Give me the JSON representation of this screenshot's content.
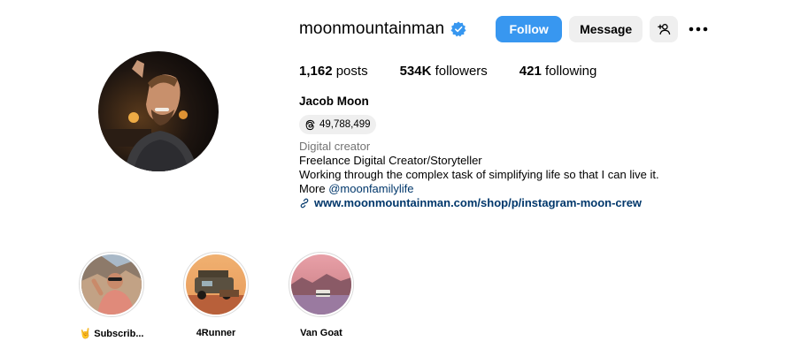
{
  "profile": {
    "username": "moonmountainman",
    "verified_icon": "verified-badge-icon",
    "follow_label": "Follow",
    "message_label": "Message",
    "more_icon": "more-options-icon",
    "add_user_icon": "suggest-user-icon",
    "full_name": "Jacob Moon",
    "threads_count": "49,788,499",
    "threads_icon": "threads-icon",
    "category": "Digital creator",
    "bio_line1": "Freelance Digital Creator/Storyteller",
    "bio_line2": "Working through the complex task of simplifying life so that I can live it.",
    "bio_line3_prefix": "More ",
    "bio_mention": "@moonfamilylife",
    "link_icon": "link-icon",
    "website": "www.moonmountainman.com/shop/p/instagram-moon-crew"
  },
  "stats": {
    "posts_count": "1,162",
    "posts_label": " posts",
    "followers_count": "534K",
    "followers_label": " followers",
    "following_count": "421",
    "following_label": " following"
  },
  "highlights": [
    {
      "label": "🤘 Subscrib..."
    },
    {
      "label": "4Runner"
    },
    {
      "label": "Van Goat"
    }
  ],
  "colors": {
    "accent": "#3897f0",
    "verified": "#3797f0",
    "link": "#00376b",
    "muted": "#737373",
    "button_gray": "#efefef"
  }
}
